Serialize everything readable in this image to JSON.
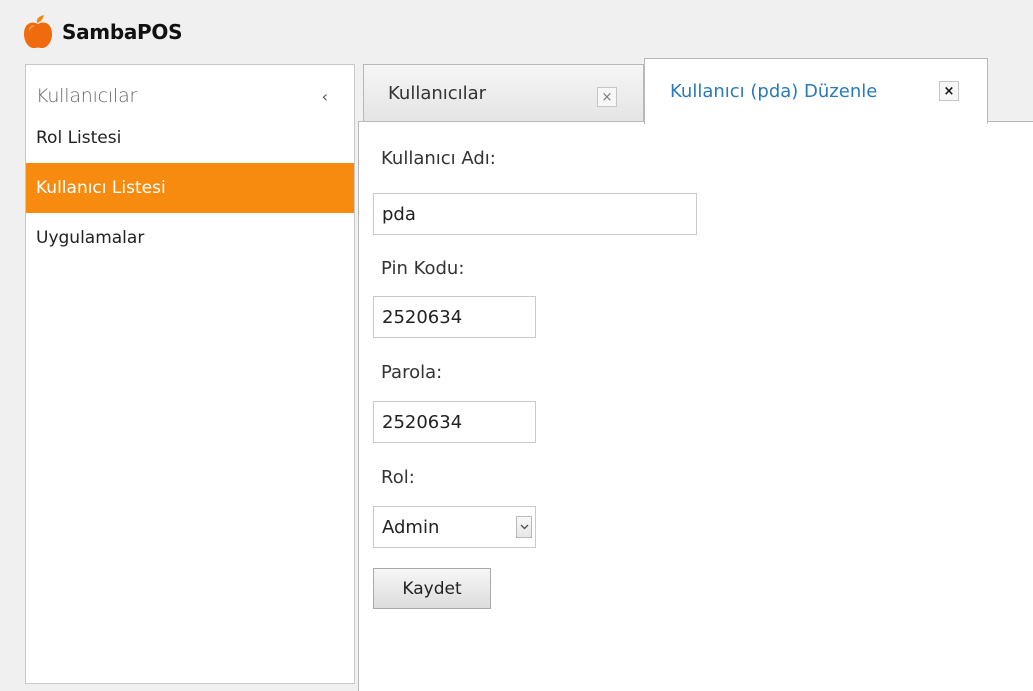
{
  "app": {
    "title": "SambaPOS",
    "logo_icon": "apple-icon",
    "accent": "#f68b0f"
  },
  "sidebar": {
    "title": "Kullanıcılar",
    "collapse_glyph": "‹",
    "items": [
      {
        "label": "Rol Listesi",
        "active": false
      },
      {
        "label": "Kullanıcı Listesi",
        "active": true
      },
      {
        "label": "Uygulamalar",
        "active": false
      }
    ]
  },
  "tabs": [
    {
      "label": "Kullanıcılar",
      "active": false,
      "close_glyph": "×"
    },
    {
      "label": "Kullanıcı (pda) Düzenle",
      "active": true,
      "close_glyph": "×"
    }
  ],
  "form": {
    "username_label": "Kullanıcı Adı:",
    "username_value": "pda",
    "pin_label": "Pin Kodu:",
    "pin_value": "2520634",
    "password_label": "Parola:",
    "password_value": "2520634",
    "role_label": "Rol:",
    "role_value": "Admin",
    "save_label": "Kaydet"
  }
}
